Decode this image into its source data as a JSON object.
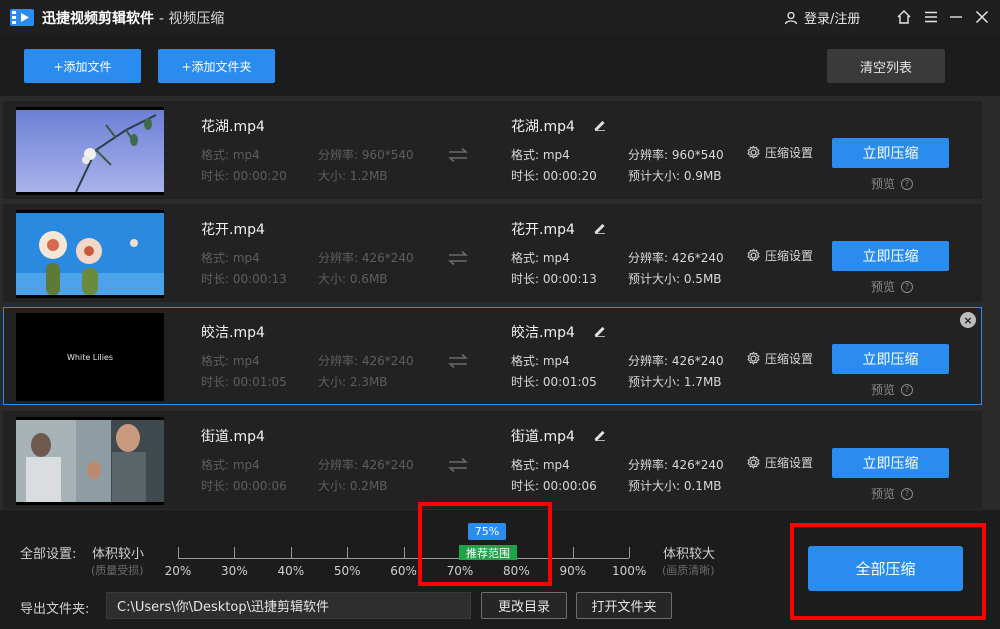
{
  "titlebar": {
    "app_name": "迅捷视频剪辑软件",
    "page_name": "- 视频压缩",
    "login_label": "登录/注册"
  },
  "toolbar": {
    "add_file": "+添加文件",
    "add_folder": "+添加文件夹",
    "clear_list": "清空列表"
  },
  "labels": {
    "format_prefix": "格式: ",
    "duration_prefix": "时长: ",
    "resolution_prefix": "分辨率: ",
    "size_prefix": "大小: ",
    "est_size_prefix": "预计大小: ",
    "settings": "压缩设置",
    "compress_now": "立即压缩",
    "preview": "预览"
  },
  "files": [
    {
      "name": "花湖.mp4",
      "format": "mp4",
      "duration": "00:00:20",
      "resolution": "960*540",
      "size": "1.2MB",
      "out_name": "花湖.mp4",
      "out_format": "mp4",
      "out_duration": "00:00:20",
      "out_resolution": "960*540",
      "est_size": "0.9MB",
      "thumb": "blue-sky-flower"
    },
    {
      "name": "花开.mp4",
      "format": "mp4",
      "duration": "00:00:13",
      "resolution": "426*240",
      "size": "0.6MB",
      "out_name": "花开.mp4",
      "out_format": "mp4",
      "out_duration": "00:00:13",
      "out_resolution": "426*240",
      "est_size": "0.5MB",
      "thumb": "cactus-flowers"
    },
    {
      "name": "皎洁.mp4",
      "format": "mp4",
      "duration": "00:01:05",
      "resolution": "426*240",
      "size": "2.3MB",
      "out_name": "皎洁.mp4",
      "out_format": "mp4",
      "out_duration": "00:01:05",
      "out_resolution": "426*240",
      "est_size": "1.7MB",
      "thumb": "black-title",
      "thumb_text": "White Lilies"
    },
    {
      "name": "街道.mp4",
      "format": "mp4",
      "duration": "00:00:06",
      "resolution": "426*240",
      "size": "0.2MB",
      "out_name": "街道.mp4",
      "out_format": "mp4",
      "out_duration": "00:00:06",
      "out_resolution": "426*240",
      "est_size": "0.1MB",
      "thumb": "street-people"
    }
  ],
  "bottom": {
    "all_settings": "全部设置:",
    "smaller": "体积较小",
    "smaller_sub": "(质量受损)",
    "larger": "体积较大",
    "larger_sub": "(画质清晰)",
    "slider_value": "75%",
    "slider_level": 0.75,
    "recommended": "推荐范围",
    "ticks": [
      "20%",
      "30%",
      "40%",
      "50%",
      "60%",
      "70%",
      "80%",
      "90%",
      "100%"
    ],
    "export_label": "导出文件夹:",
    "export_path": "C:\\Users\\你\\Desktop\\迅捷剪辑软件",
    "change_dir": "更改目录",
    "open_folder": "打开文件夹",
    "compress_all": "全部压缩"
  },
  "colors": {
    "accent": "#2b8cf0",
    "recommend": "#1fa34a",
    "highlight": "#ff0000"
  }
}
